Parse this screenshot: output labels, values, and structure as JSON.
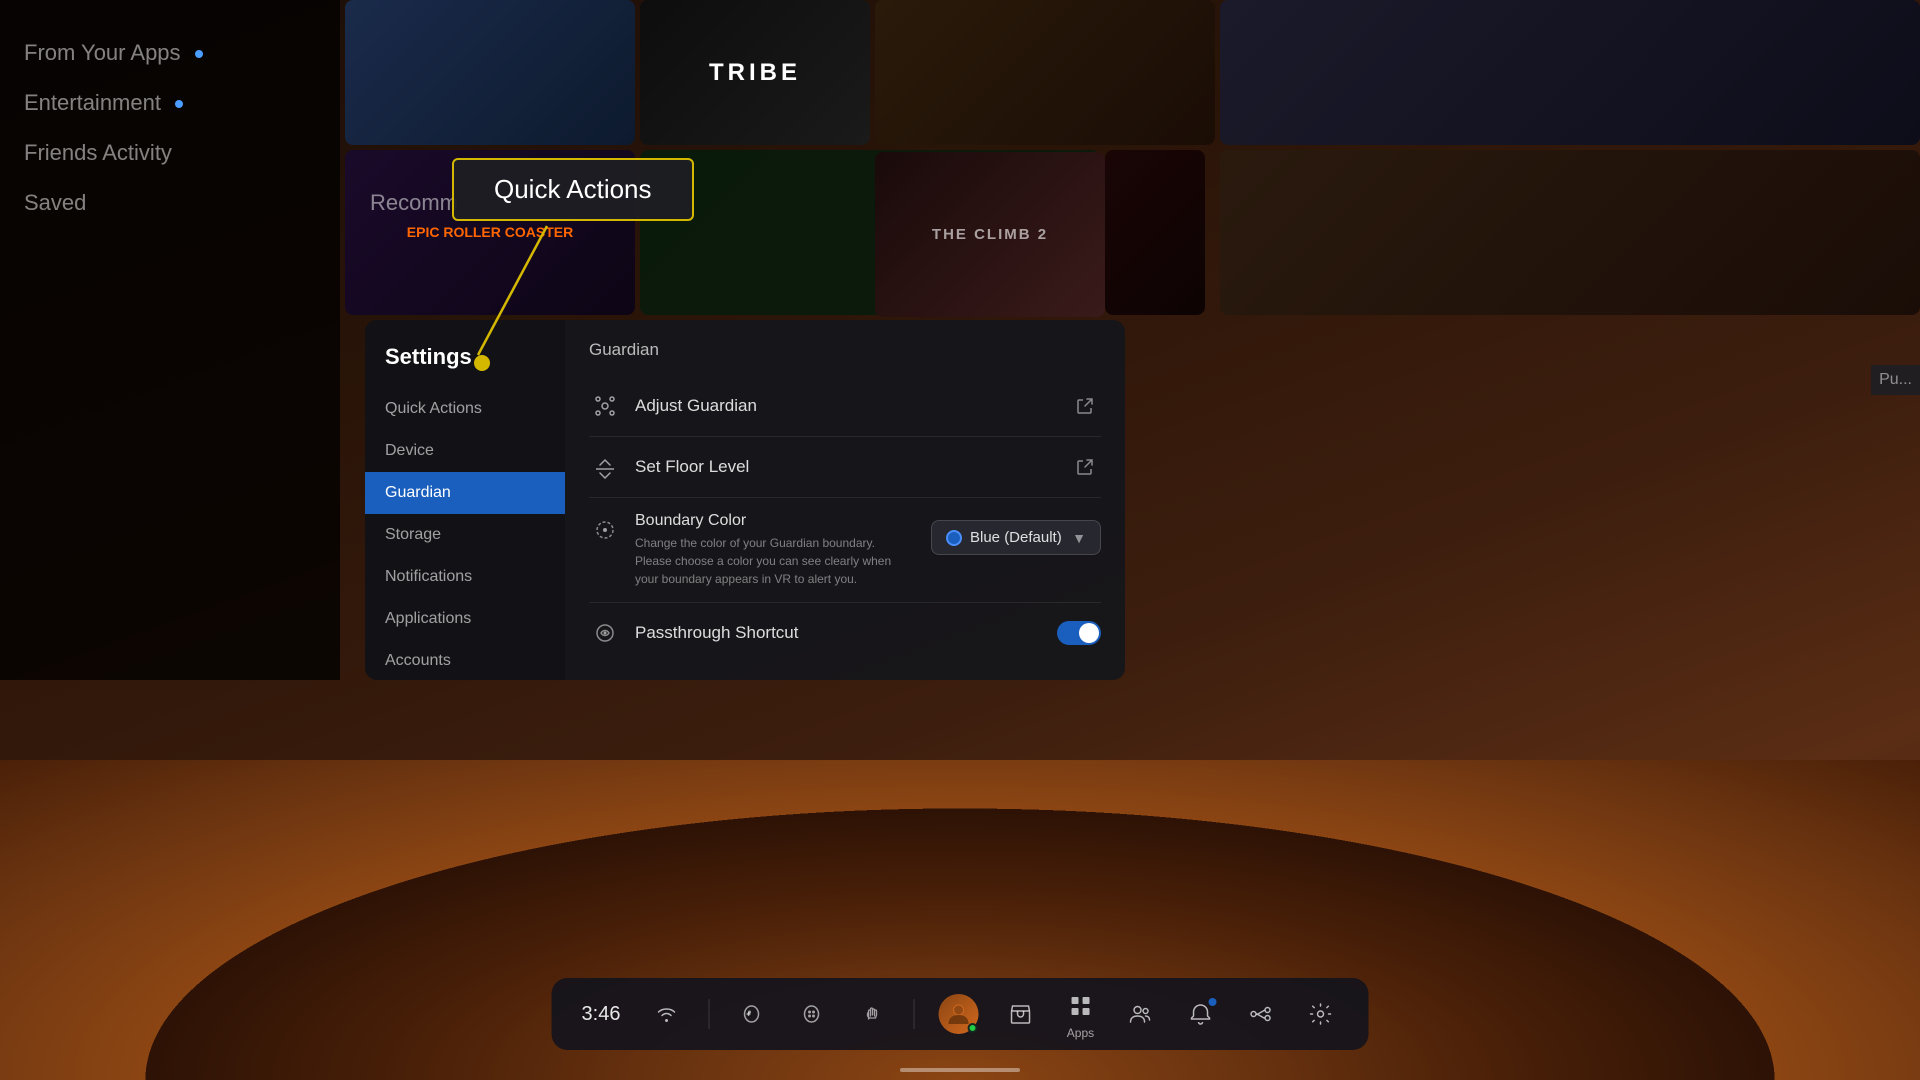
{
  "background": {
    "color": "#1a0e08"
  },
  "tooltip": {
    "title": "Quick Actions",
    "border_color": "#d4b800"
  },
  "left_nav": {
    "items": [
      {
        "label": "From Your Apps",
        "has_dot": true,
        "active": false
      },
      {
        "label": "Entertainment",
        "has_dot": true,
        "active": false
      },
      {
        "label": "Friends Activity",
        "active": false
      },
      {
        "label": "Saved",
        "active": false
      }
    ]
  },
  "settings": {
    "title": "Settings",
    "nav_items": [
      {
        "label": "Quick Actions",
        "active": false
      },
      {
        "label": "Device",
        "active": false
      },
      {
        "label": "Guardian",
        "active": true
      },
      {
        "label": "Storage",
        "active": false
      },
      {
        "label": "Notifications",
        "active": false
      },
      {
        "label": "Applications",
        "active": false
      },
      {
        "label": "Accounts",
        "active": false
      }
    ],
    "content": {
      "section_title": "Guardian",
      "items": [
        {
          "label": "Adjust Guardian",
          "has_action": true
        },
        {
          "label": "Set Floor Level",
          "has_action": true
        }
      ],
      "boundary": {
        "label": "Boundary Color",
        "description": "Change the color of your Guardian boundary. Please choose a color you can see clearly when your boundary appears in VR to alert you.",
        "selected": "Blue (Default)"
      },
      "passthrough": {
        "label": "Passthrough Shortcut",
        "enabled": true
      }
    }
  },
  "taskbar": {
    "time": "3:46",
    "icons": [
      {
        "name": "controller-left-icon",
        "label": ""
      },
      {
        "name": "controller-right-icon",
        "label": ""
      },
      {
        "name": "controller-hand-icon",
        "label": ""
      },
      {
        "name": "avatar-icon",
        "label": ""
      },
      {
        "name": "store-icon",
        "label": ""
      },
      {
        "name": "apps-icon",
        "label": "Apps"
      },
      {
        "name": "people-icon",
        "label": ""
      },
      {
        "name": "notifications-icon",
        "label": "",
        "has_dot": true
      },
      {
        "name": "share-icon",
        "label": ""
      },
      {
        "name": "settings-icon",
        "label": ""
      }
    ]
  },
  "tiles": [
    {
      "id": "tile-tribe",
      "label": "TRIBE"
    },
    {
      "id": "tile-epic",
      "label": "Epic Roller Coaster"
    },
    {
      "id": "tile-climb",
      "label": "THE CLIMB 2"
    },
    {
      "id": "tile-partial",
      "label": "Pu..."
    }
  ]
}
